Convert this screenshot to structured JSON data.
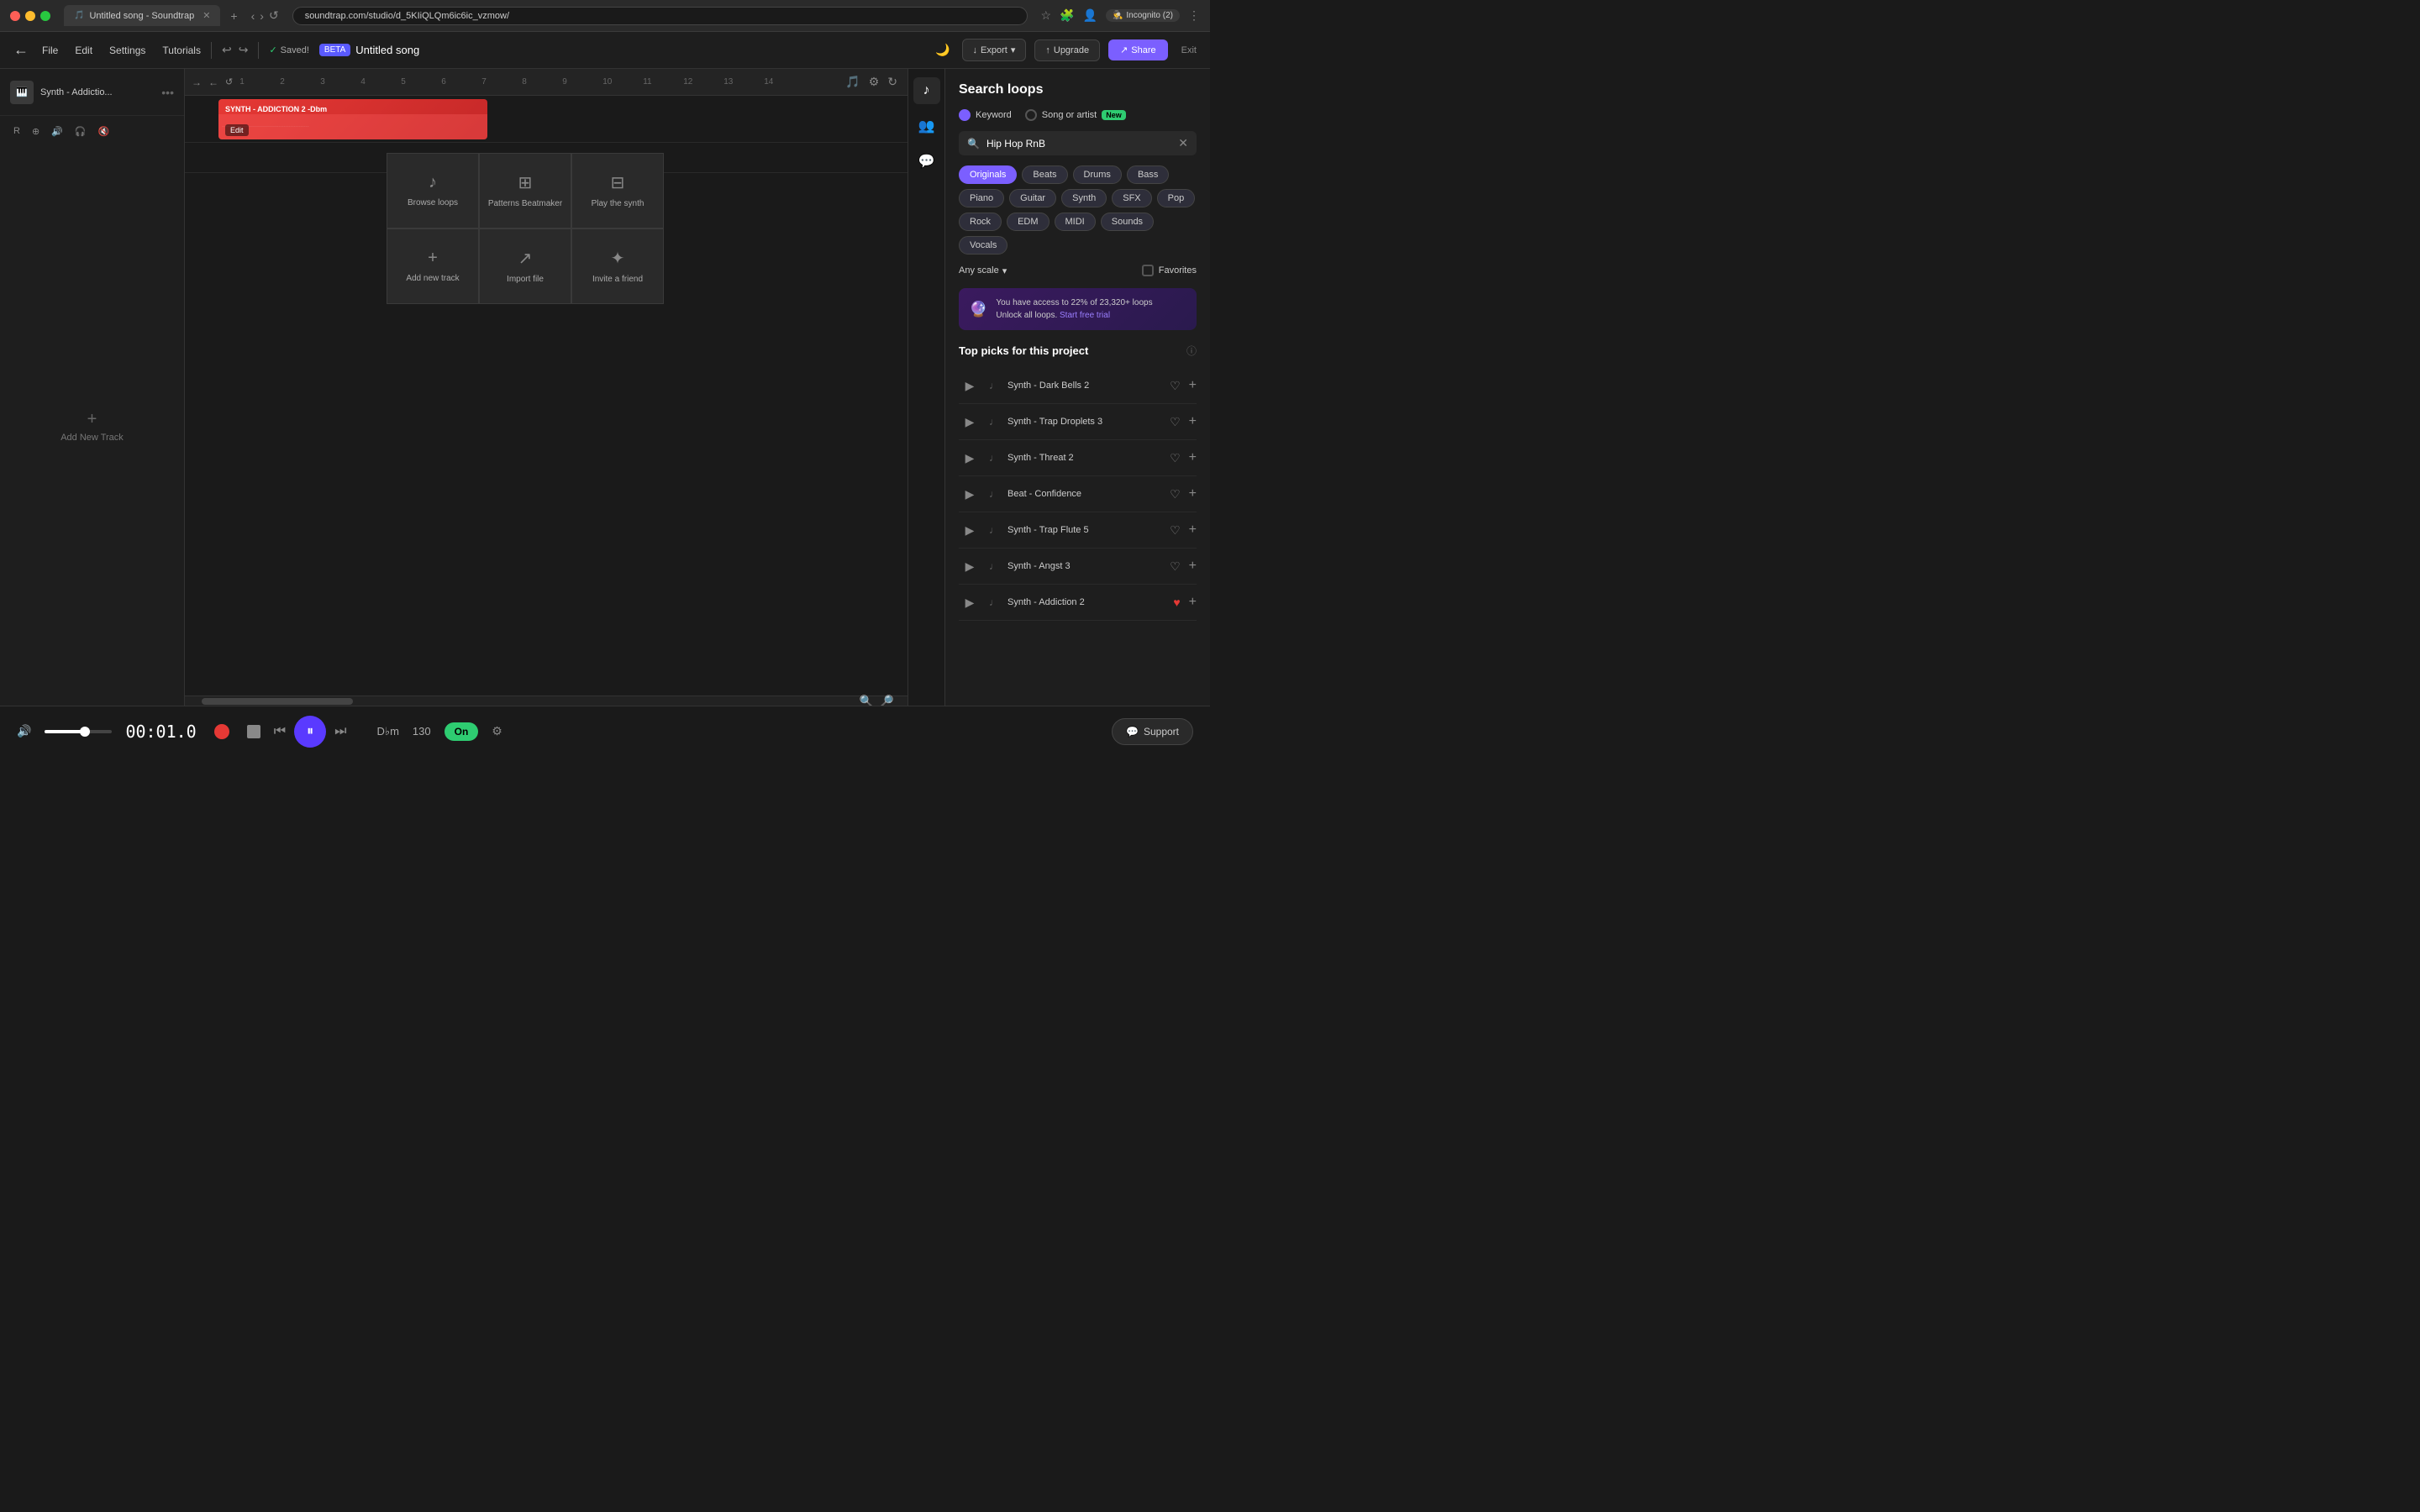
{
  "browser": {
    "tab_title": "Untitled song - Soundtrap",
    "url": "soundtrap.com/studio/d_5KIiQLQm6ic6ic_vzmow/",
    "incognito_label": "Incognito (2)"
  },
  "menubar": {
    "back_icon": "←",
    "file_label": "File",
    "edit_label": "Edit",
    "settings_label": "Settings",
    "tutorials_label": "Tutorials",
    "undo_icon": "↩",
    "redo_icon": "↪",
    "saved_label": "Saved!",
    "beta_label": "BETA",
    "song_title": "Untitled song",
    "export_label": "Export",
    "upgrade_label": "Upgrade",
    "share_label": "Share",
    "exit_label": "Exit"
  },
  "sidebar": {
    "track_name": "Synth - Addictio...",
    "track_icon": "🎹",
    "add_track_label": "Add New Track"
  },
  "timeline": {
    "ruler_marks": [
      "1",
      "2",
      "3",
      "4",
      "5",
      "6",
      "7",
      "8",
      "9",
      "10",
      "11",
      "12",
      "13",
      "14"
    ],
    "clip_label": "SYNTH - ADDICTION 2 -Dbm",
    "edit_label": "Edit"
  },
  "action_grid": [
    {
      "icon": "♪",
      "label": "Browse loops"
    },
    {
      "icon": "⊞",
      "label": "Patterns Beatmaker"
    },
    {
      "icon": "⊟",
      "label": "Play the synth"
    },
    {
      "icon": "+",
      "label": "Add new track"
    },
    {
      "icon": "↗",
      "label": "Import file"
    },
    {
      "icon": "✦+",
      "label": "Invite a friend"
    }
  ],
  "right_panel": {
    "search_loops_title": "Search loops",
    "keyword_label": "Keyword",
    "song_or_artist_label": "Song or artist",
    "new_label": "New",
    "search_value": "Hip Hop RnB",
    "filters": [
      {
        "label": "Originals",
        "active": true
      },
      {
        "label": "Beats",
        "active": false
      },
      {
        "label": "Drums",
        "active": false
      },
      {
        "label": "Bass",
        "active": false
      },
      {
        "label": "Piano",
        "active": false
      },
      {
        "label": "Guitar",
        "active": false
      },
      {
        "label": "Synth",
        "active": false
      },
      {
        "label": "SFX",
        "active": false
      },
      {
        "label": "Pop",
        "active": false
      },
      {
        "label": "Rock",
        "active": false
      },
      {
        "label": "EDM",
        "active": false
      },
      {
        "label": "MIDI",
        "active": false
      },
      {
        "label": "Sounds",
        "active": false
      },
      {
        "label": "Vocals",
        "active": false
      }
    ],
    "scale_label": "Any scale",
    "favorites_label": "Favorites",
    "access_text": "You have access to 22% of 23,320+ loops",
    "access_link_text": "Start free trial",
    "top_picks_title": "Top picks for this project",
    "loops": [
      {
        "name": "Synth - Dark Bells 2",
        "liked": false
      },
      {
        "name": "Synth - Trap Droplets 3",
        "liked": false
      },
      {
        "name": "Synth - Threat 2",
        "liked": false
      },
      {
        "name": "Beat - Confidence",
        "liked": false
      },
      {
        "name": "Synth - Trap Flute 5",
        "liked": false
      },
      {
        "name": "Synth - Angst 3",
        "liked": false
      },
      {
        "name": "Synth - Addiction 2",
        "liked": true
      }
    ]
  },
  "transport": {
    "time": "00:01.0",
    "key": "D♭m",
    "bpm": "130",
    "on_label": "On",
    "support_label": "Support",
    "play_icon": "⏸",
    "rewind_icon": "⏪",
    "forward_icon": "⏩"
  }
}
